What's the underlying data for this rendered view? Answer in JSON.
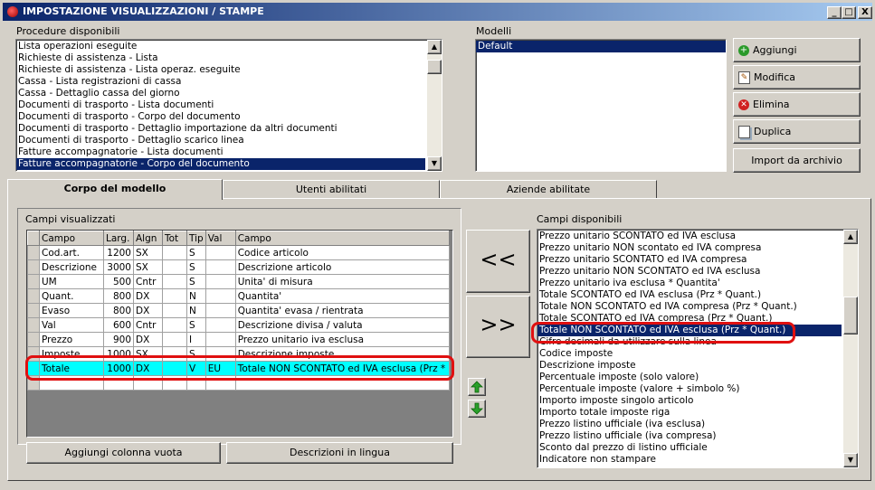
{
  "window": {
    "title": "IMPOSTAZIONE VISUALIZZAZIONI / STAMPE",
    "min": "_",
    "max": "□",
    "close": "X"
  },
  "procedure": {
    "label": "Procedure disponibili",
    "items": [
      "Lista operazioni eseguite",
      "Richieste di assistenza - Lista",
      "Richieste di assistenza - Lista operaz. eseguite",
      "Cassa - Lista registrazioni di cassa",
      "Cassa - Dettaglio cassa del giorno",
      "Documenti di trasporto - Lista documenti",
      "Documenti di trasporto - Corpo del documento",
      "Documenti di trasporto - Dettaglio importazione da altri documenti",
      "Documenti di trasporto - Dettaglio scarico linea",
      "Fatture accompagnatorie - Lista documenti",
      "Fatture accompagnatorie - Corpo del documento"
    ],
    "selected_index": 10
  },
  "modelli": {
    "label": "Modelli",
    "items": [
      "Default"
    ]
  },
  "buttons": {
    "aggiungi": "Aggiungi",
    "modifica": "Modifica",
    "elimina": "Elimina",
    "duplica": "Duplica",
    "import": "Import da archivio"
  },
  "tabs": [
    "Corpo del modello",
    "Utenti abilitati",
    "Aziende abilitate"
  ],
  "campi_visualizzati": {
    "label": "Campi visualizzati",
    "columns": [
      "Campo",
      "Larg.",
      "Algn",
      "Tot",
      "Tip",
      "Val",
      "Campo"
    ],
    "rows": [
      [
        "Cod.art.",
        "1200",
        "SX",
        "",
        "S",
        "",
        "Codice articolo"
      ],
      [
        "Descrizione",
        "3000",
        "SX",
        "",
        "S",
        "",
        "Descrizione articolo"
      ],
      [
        "UM",
        "500",
        "Cntr",
        "",
        "S",
        "",
        "Unita' di misura"
      ],
      [
        "Quant.",
        "800",
        "DX",
        "",
        "N",
        "",
        "Quantita'"
      ],
      [
        "Evaso",
        "800",
        "DX",
        "",
        "N",
        "",
        "Quantita' evasa / rientrata"
      ],
      [
        "Val",
        "600",
        "Cntr",
        "",
        "S",
        "",
        "Descrizione divisa / valuta"
      ],
      [
        "Prezzo",
        "900",
        "DX",
        "",
        "I",
        "",
        "Prezzo unitario iva esclusa"
      ],
      [
        "Imposte",
        "1000",
        "SX",
        "",
        "S",
        "",
        "Descrizione imposte"
      ],
      [
        "Totale",
        "1000",
        "DX",
        "",
        "V",
        "EU",
        "Totale NON SCONTATO ed IVA esclusa (Prz *"
      ]
    ],
    "highlight_index": 8
  },
  "transfer": {
    "left": "<<",
    "right": ">>"
  },
  "bottom_buttons": {
    "add_col": "Aggiungi colonna vuota",
    "desc": "Descrizioni in lingua"
  },
  "campi_disponibili": {
    "label": "Campi disponibili",
    "items": [
      "Prezzo unitario SCONTATO ed IVA esclusa",
      "Prezzo unitario NON scontato ed IVA compresa",
      "Prezzo unitario SCONTATO ed IVA compresa",
      "Prezzo unitario NON SCONTATO ed IVA esclusa",
      "Prezzo unitario iva esclusa * Quantita'",
      "Totale SCONTATO ed IVA esclusa (Prz * Quant.)",
      "Totale NON SCONTATO ed IVA compresa (Prz * Quant.)",
      "Totale SCONTATO ed IVA compresa (Prz * Quant.)",
      "Totale NON SCONTATO ed IVA esclusa (Prz * Quant.)",
      "Cifre decimali da utilizzare sulla linea",
      "Codice imposte",
      "Descrizione imposte",
      "Percentuale imposte (solo valore)",
      "Percentuale imposte (valore + simbolo %)",
      "Importo imposte singolo articolo",
      "Importo totale imposte riga",
      "Prezzo listino ufficiale (iva esclusa)",
      "Prezzo listino ufficiale (iva compresa)",
      "Sconto dal prezzo di listino ufficiale",
      "Indicatore non stampare"
    ],
    "selected_index": 8
  },
  "colors": {
    "selection": "#0a246a",
    "highlight_row": "#00ffff",
    "annotation": "#e01010"
  }
}
